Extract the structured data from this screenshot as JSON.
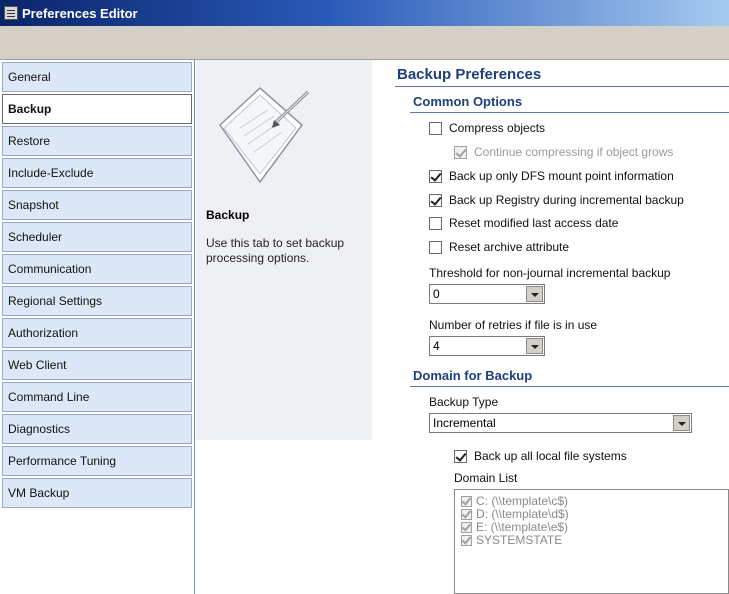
{
  "window": {
    "title": "Preferences Editor"
  },
  "sidebar": {
    "tabs": [
      {
        "label": "General",
        "active": false
      },
      {
        "label": "Backup",
        "active": true
      },
      {
        "label": "Restore",
        "active": false
      },
      {
        "label": "Include-Exclude",
        "active": false
      },
      {
        "label": "Snapshot",
        "active": false
      },
      {
        "label": "Scheduler",
        "active": false
      },
      {
        "label": "Communication",
        "active": false
      },
      {
        "label": "Regional Settings",
        "active": false
      },
      {
        "label": "Authorization",
        "active": false
      },
      {
        "label": "Web Client",
        "active": false
      },
      {
        "label": "Command Line",
        "active": false
      },
      {
        "label": "Diagnostics",
        "active": false
      },
      {
        "label": "Performance Tuning",
        "active": false
      },
      {
        "label": "VM Backup",
        "active": false
      }
    ]
  },
  "info": {
    "icon": "document-pencil-icon",
    "title": "Backup",
    "description": "Use this tab to set backup processing options."
  },
  "main": {
    "title": "Backup Preferences",
    "common": {
      "title": "Common Options",
      "compress": {
        "label": "Compress objects",
        "checked": false,
        "disabled": false
      },
      "continue_compress": {
        "label": "Continue compressing if object grows",
        "checked": true,
        "disabled": true
      },
      "dfs": {
        "label": "Back up only DFS mount point information",
        "checked": true
      },
      "registry": {
        "label": "Back up Registry during incremental backup",
        "checked": true
      },
      "reset_access": {
        "label": "Reset modified last access date",
        "checked": false
      },
      "reset_archive": {
        "label": "Reset archive attribute",
        "checked": false
      },
      "threshold": {
        "label": "Threshold for non-journal incremental backup",
        "value": "0"
      },
      "retries": {
        "label": "Number of retries if file is in use",
        "value": "4"
      }
    },
    "domain": {
      "title": "Domain for Backup",
      "backup_type_label": "Backup Type",
      "backup_type_value": "Incremental",
      "all_local": {
        "label": "Back up all local file systems",
        "checked": true
      },
      "list_label": "Domain List",
      "items": [
        "C: (\\\\template\\c$)",
        "D: (\\\\template\\d$)",
        "E: (\\\\template\\e$)",
        "SYSTEMSTATE"
      ]
    }
  }
}
